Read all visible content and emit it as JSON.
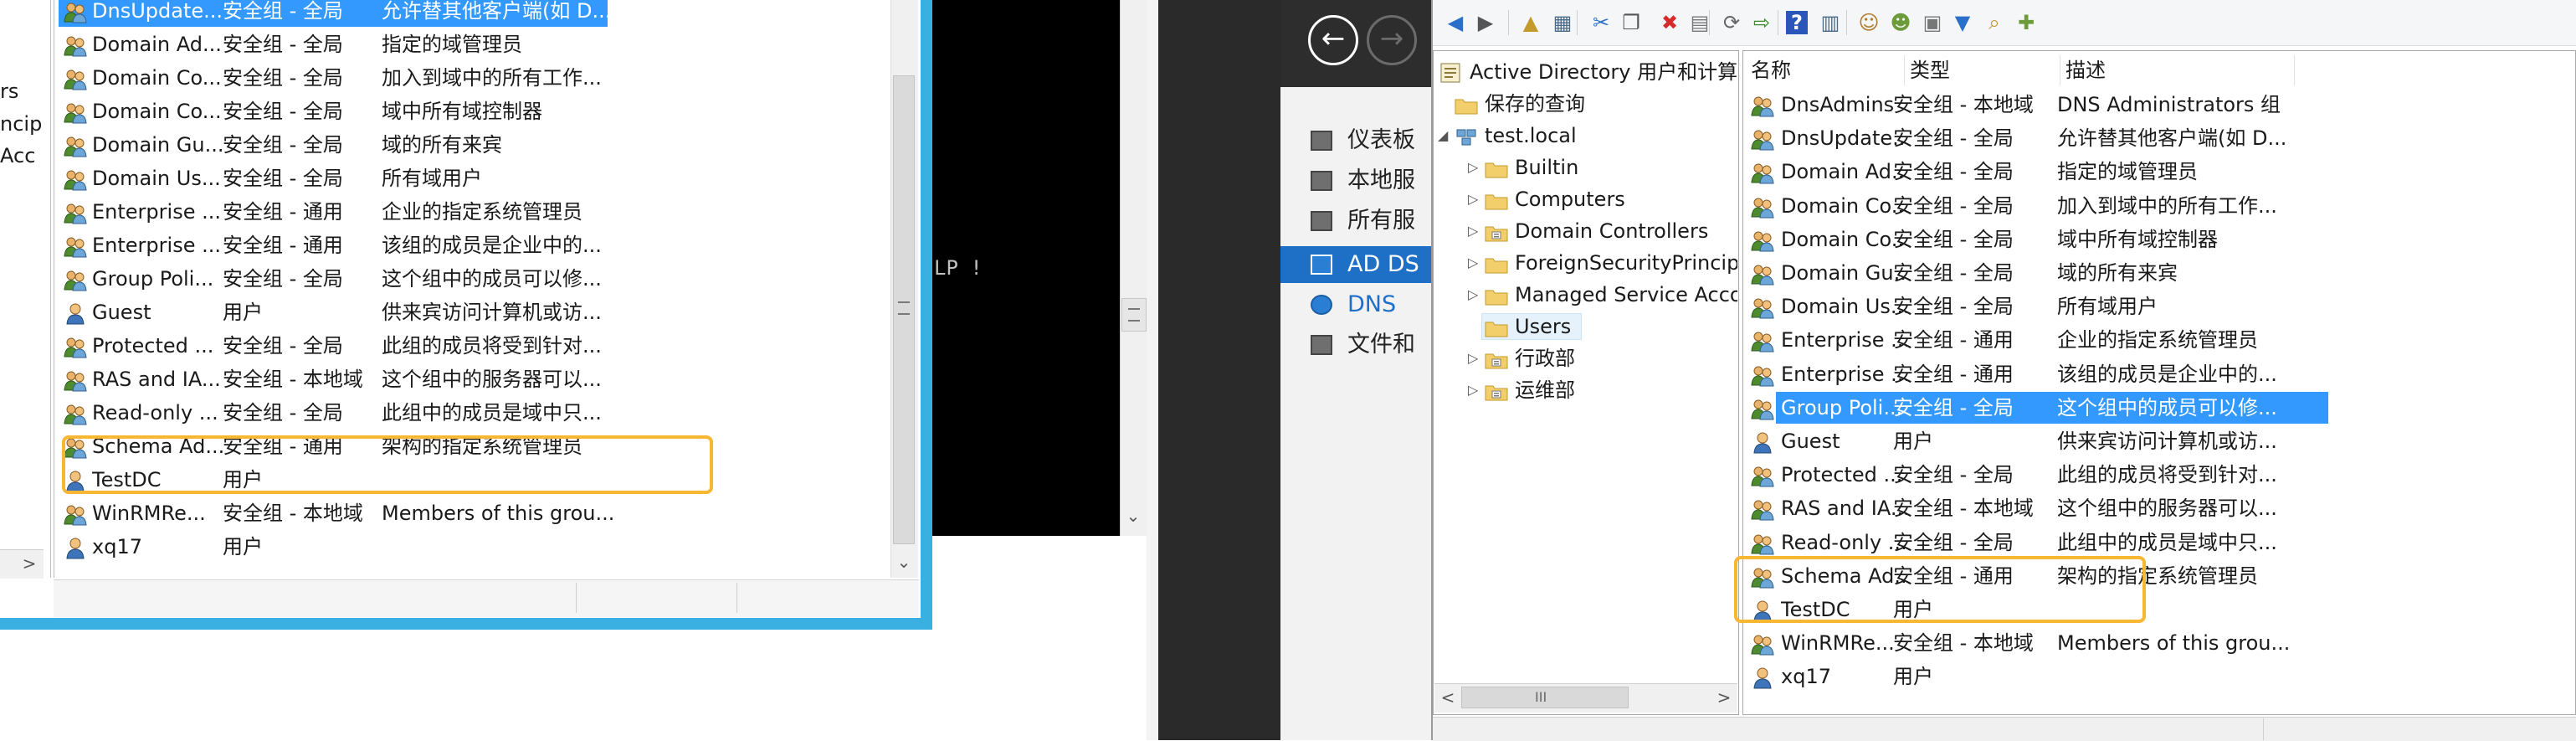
{
  "left_window": {
    "partial_labels": [
      "rs",
      "ncip",
      "Acc"
    ],
    "rows": [
      {
        "icon": "group-icon",
        "name": "DnsUpdate...",
        "type": "安全组 - 全局",
        "desc": "允许替其他客户端(如 D...",
        "selected": true
      },
      {
        "icon": "group-icon",
        "name": "Domain Ad...",
        "type": "安全组 - 全局",
        "desc": "指定的域管理员"
      },
      {
        "icon": "group-icon",
        "name": "Domain Co...",
        "type": "安全组 - 全局",
        "desc": "加入到域中的所有工作..."
      },
      {
        "icon": "group-icon",
        "name": "Domain Co...",
        "type": "安全组 - 全局",
        "desc": "域中所有域控制器"
      },
      {
        "icon": "group-icon",
        "name": "Domain Gu...",
        "type": "安全组 - 全局",
        "desc": "域的所有来宾"
      },
      {
        "icon": "group-icon",
        "name": "Domain Us...",
        "type": "安全组 - 全局",
        "desc": "所有域用户"
      },
      {
        "icon": "group-icon",
        "name": "Enterprise ...",
        "type": "安全组 - 通用",
        "desc": "企业的指定系统管理员"
      },
      {
        "icon": "group-icon",
        "name": "Enterprise ...",
        "type": "安全组 - 通用",
        "desc": "该组的成员是企业中的..."
      },
      {
        "icon": "group-icon",
        "name": "Group Poli...",
        "type": "安全组 - 全局",
        "desc": "这个组中的成员可以修..."
      },
      {
        "icon": "user-icon",
        "name": "Guest",
        "type": "用户",
        "desc": "供来宾访问计算机或访..."
      },
      {
        "icon": "group-icon",
        "name": "Protected ...",
        "type": "安全组 - 全局",
        "desc": "此组的成员将受到针对..."
      },
      {
        "icon": "group-icon",
        "name": "RAS and IA...",
        "type": "安全组 - 本地域",
        "desc": "这个组中的服务器可以..."
      },
      {
        "icon": "group-icon",
        "name": "Read-only ...",
        "type": "安全组 - 全局",
        "desc": "此组中的成员是域中只..."
      },
      {
        "icon": "group-icon",
        "name": "Schema Ad...",
        "type": "安全组 - 通用",
        "desc": "架构的指定系统管理员"
      },
      {
        "icon": "user-icon",
        "name": "TestDC",
        "type": "用户",
        "desc": ""
      },
      {
        "icon": "group-icon",
        "name": "WinRMRe...",
        "type": "安全组 - 本地域",
        "desc": "Members of this grou..."
      },
      {
        "icon": "user-icon",
        "name": "xq17",
        "type": "用户",
        "desc": ""
      }
    ]
  },
  "console": {
    "text": "LP !"
  },
  "server_manager": {
    "nav": [
      {
        "icon": "dashboard-icon",
        "label": "仪表板"
      },
      {
        "icon": "server-icon",
        "label": "本地服"
      },
      {
        "icon": "servers-icon",
        "label": "所有服"
      },
      {
        "icon": "ad-ds-icon",
        "label": "AD DS",
        "selected": true
      },
      {
        "icon": "dns-icon",
        "label": "DNS"
      },
      {
        "icon": "file-icon",
        "label": "文件和"
      }
    ]
  },
  "aduc": {
    "tree": [
      {
        "label": "Active Directory 用户和计算机",
        "level": 0,
        "expander": "",
        "icon": "ad-root-icon"
      },
      {
        "label": "保存的查询",
        "level": 1,
        "expander": "",
        "icon": "folder-icon"
      },
      {
        "label": "test.local",
        "level": 1,
        "expander": "◢",
        "icon": "domain-icon"
      },
      {
        "label": "Builtin",
        "level": 2,
        "expander": "▷",
        "icon": "folder-icon"
      },
      {
        "label": "Computers",
        "level": 2,
        "expander": "▷",
        "icon": "folder-icon"
      },
      {
        "label": "Domain Controllers",
        "level": 2,
        "expander": "▷",
        "icon": "ou-icon"
      },
      {
        "label": "ForeignSecurityPrincipa",
        "level": 2,
        "expander": "▷",
        "icon": "folder-icon"
      },
      {
        "label": "Managed Service Acco",
        "level": 2,
        "expander": "▷",
        "icon": "folder-icon"
      },
      {
        "label": "Users",
        "level": 2,
        "expander": "",
        "icon": "folder-icon",
        "selected": true
      },
      {
        "label": "行政部",
        "level": 2,
        "expander": "▷",
        "icon": "ou-icon"
      },
      {
        "label": "运维部",
        "level": 2,
        "expander": "▷",
        "icon": "ou-icon"
      }
    ],
    "columns": [
      "名称",
      "类型",
      "描述"
    ],
    "rows": [
      {
        "icon": "group-icon",
        "name": "DnsAdmins",
        "type": "安全组 - 本地域",
        "desc": "DNS Administrators 组"
      },
      {
        "icon": "group-icon",
        "name": "DnsUpdate...",
        "type": "安全组 - 全局",
        "desc": "允许替其他客户端(如 D..."
      },
      {
        "icon": "group-icon",
        "name": "Domain Ad...",
        "type": "安全组 - 全局",
        "desc": "指定的域管理员"
      },
      {
        "icon": "group-icon",
        "name": "Domain Co...",
        "type": "安全组 - 全局",
        "desc": "加入到域中的所有工作..."
      },
      {
        "icon": "group-icon",
        "name": "Domain Co...",
        "type": "安全组 - 全局",
        "desc": "域中所有域控制器"
      },
      {
        "icon": "group-icon",
        "name": "Domain Gu...",
        "type": "安全组 - 全局",
        "desc": "域的所有来宾"
      },
      {
        "icon": "group-icon",
        "name": "Domain Us...",
        "type": "安全组 - 全局",
        "desc": "所有域用户"
      },
      {
        "icon": "group-icon",
        "name": "Enterprise ...",
        "type": "安全组 - 通用",
        "desc": "企业的指定系统管理员"
      },
      {
        "icon": "group-icon",
        "name": "Enterprise ...",
        "type": "安全组 - 通用",
        "desc": "该组的成员是企业中的..."
      },
      {
        "icon": "group-icon",
        "name": "Group Poli...",
        "type": "安全组 - 全局",
        "desc": "这个组中的成员可以修...",
        "selected": true
      },
      {
        "icon": "user-icon",
        "name": "Guest",
        "type": "用户",
        "desc": "供来宾访问计算机或访..."
      },
      {
        "icon": "group-icon",
        "name": "Protected ...",
        "type": "安全组 - 全局",
        "desc": "此组的成员将受到针对..."
      },
      {
        "icon": "group-icon",
        "name": "RAS and IA...",
        "type": "安全组 - 本地域",
        "desc": "这个组中的服务器可以..."
      },
      {
        "icon": "group-icon",
        "name": "Read-only ...",
        "type": "安全组 - 全局",
        "desc": "此组中的成员是域中只..."
      },
      {
        "icon": "group-icon",
        "name": "Schema Ad...",
        "type": "安全组 - 通用",
        "desc": "架构的指定系统管理员"
      },
      {
        "icon": "user-icon",
        "name": "TestDC",
        "type": "用户",
        "desc": ""
      },
      {
        "icon": "group-icon",
        "name": "WinRMRe...",
        "type": "安全组 - 本地域",
        "desc": "Members of this grou..."
      },
      {
        "icon": "user-icon",
        "name": "xq17",
        "type": "用户",
        "desc": ""
      }
    ],
    "scroll_thumb_glyph": "III",
    "toolbar": [
      "back-arrow-icon",
      "forward-arrow-icon",
      "up-folder-icon",
      "show-console-tree-icon",
      "cut-icon",
      "copy-icon",
      "delete-icon",
      "properties-icon",
      "refresh-icon",
      "export-list-icon",
      "help-icon",
      "show-pane-icon",
      "add-user-icon",
      "add-group-icon",
      "add-ou-icon",
      "filter-icon",
      "find-icon",
      "add-to-group-icon"
    ]
  },
  "colors": {
    "selection": "#3399ff",
    "highlight_box": "#f7b733",
    "window_border": "#3ab0e2",
    "console_bg": "#000000",
    "server_manager_nav_bg": "#eeeeee",
    "dark_header": "#2d2d2d"
  }
}
